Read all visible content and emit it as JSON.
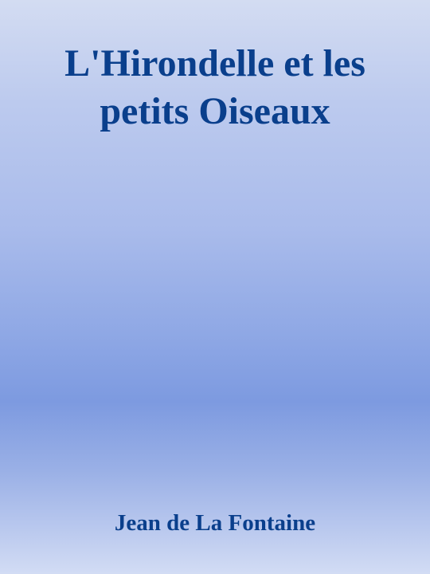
{
  "cover": {
    "title_line1": "L'Hirondelle et les",
    "title_line2": "petits Oiseaux",
    "author": "Jean de La Fontaine"
  },
  "colors": {
    "text": "#0a3f8c",
    "background_top": "#d3dcf2",
    "background_middle": "#7d9ae0",
    "background_bottom": "#d2dcf4"
  }
}
